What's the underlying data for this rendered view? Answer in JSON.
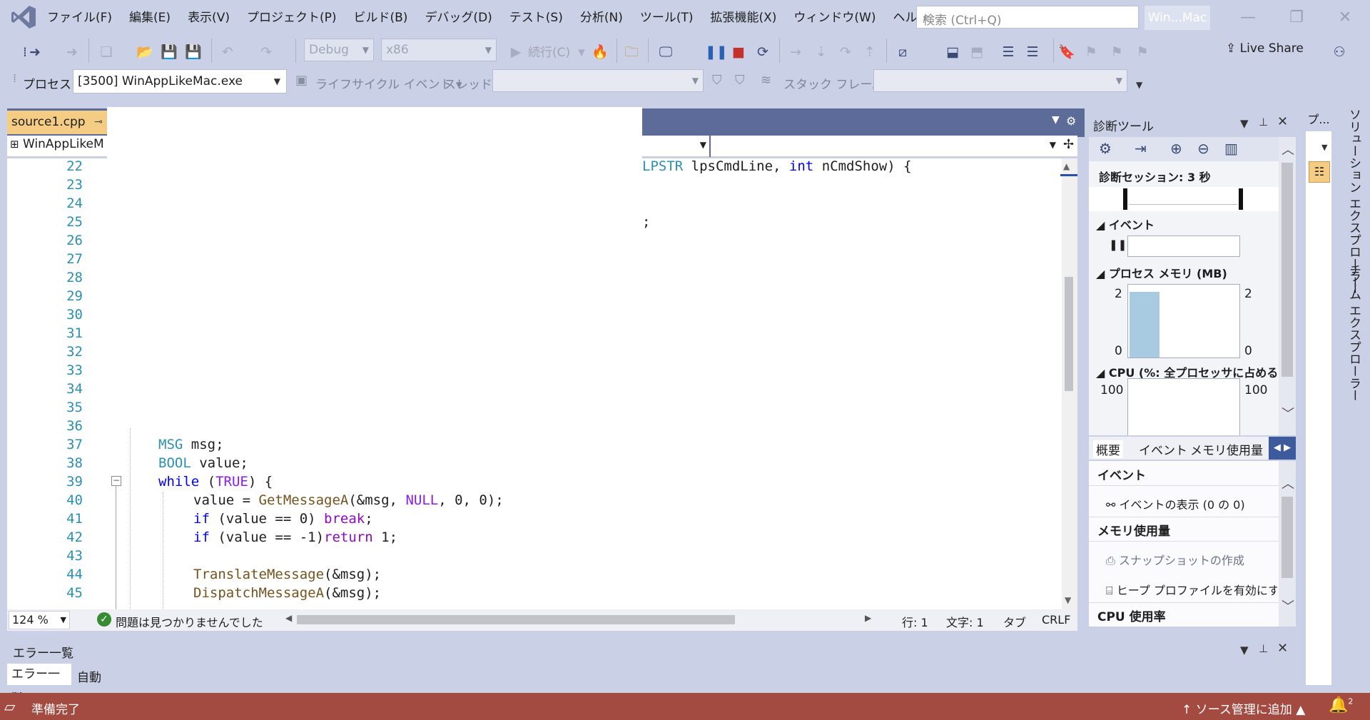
{
  "menu": {
    "items": [
      "ファイル(F)",
      "編集(E)",
      "表示(V)",
      "プロジェクト(P)",
      "ビルド(B)",
      "デバッグ(D)",
      "テスト(S)",
      "分析(N)",
      "ツール(T)",
      "拡張機能(X)",
      "ウィンドウ(W)",
      "ヘルプ(H)"
    ],
    "search_placeholder": "検索 (Ctrl+Q)",
    "window_badge": "Win...Mac"
  },
  "toolbar": {
    "config": "Debug",
    "platform": "x86",
    "continue_label": "続行(C)",
    "live_share": "Live Share"
  },
  "debug_bar": {
    "process_label": "プロセス:",
    "process_value": "[3500] WinAppLikeMac.exe",
    "lifecycle_label": "ライフサイクル イベント",
    "thread_label": "スレッド:",
    "stack_label": "スタック フレーム:"
  },
  "editor": {
    "tab_name": "source1.cpp",
    "tab_pin": "⊸",
    "nav_project": "WinAppLikeM",
    "line_numbers": [
      "22",
      "23",
      "24",
      "25",
      "26",
      "27",
      "28",
      "29",
      "30",
      "31",
      "32",
      "33",
      "34",
      "35",
      "36",
      "37",
      "38",
      "39",
      "40",
      "41",
      "42",
      "43",
      "44",
      "45"
    ],
    "line22_visible": {
      "type": "LPSTR",
      "arg1": " lpsCmdLine, ",
      "kw": "int",
      "arg2": " nCmdShow) {"
    },
    "line25_visible": ";",
    "line37": {
      "type": "MSG",
      "rest": " msg;"
    },
    "line38": {
      "type": "BOOL",
      "rest": " value;"
    },
    "line39": {
      "kw": "while",
      "p1": " (",
      "mac": "TRUE",
      "p2": ") {"
    },
    "line40": {
      "p1": "value = ",
      "fn": "GetMessageA",
      "p2": "(&msg, ",
      "mac": "NULL",
      "p3": ", 0, 0);"
    },
    "line41": {
      "kw": "if",
      "p1": " (value == 0) ",
      "ct": "break",
      "p2": ";"
    },
    "line42": {
      "kw": "if",
      "p1": " (value == -1)",
      "ct": "return",
      "p2": " 1;"
    },
    "line44": {
      "fn": "TranslateMessage",
      "rest": "(&msg);"
    },
    "line45": {
      "fn": "DispatchMessageA",
      "rest": "(&msg);"
    },
    "zoom": "124 %",
    "issues": "問題は見つかりませんでした",
    "line_pos": "行: 1",
    "char_pos": "文字: 1",
    "tab_mode": "タブ",
    "eol": "CRLF"
  },
  "diagnostics": {
    "title": "診断ツール",
    "session": "診断セッション: 3 秒",
    "events_section": "イベント",
    "memory_section": "プロセス メモリ (MB)",
    "mem_max_left": "2",
    "mem_min_left": "0",
    "mem_max_right": "2",
    "mem_min_right": "0",
    "mem_level": 0.9,
    "cpu_section": "CPU (%: 全プロセッサに占める割",
    "cpu_max_left": "100",
    "cpu_max_right": "100",
    "tabs": [
      "概要",
      "イベント",
      "メモリ使用量"
    ],
    "summary": {
      "events_head": "イベント",
      "show_events": "イベントの表示 (0 の 0)",
      "memory_head": "メモリ使用量",
      "snapshot": "スナップショットの作成",
      "heap": "ヒープ プロファイルを有効にす",
      "cpu_head": "CPU 使用率"
    }
  },
  "side": {
    "strip_head": "プ...",
    "solution_explorer": "ソリューション エクスプローラー",
    "team_explorer": "チーム エクスプローラー"
  },
  "error_list": {
    "title": "エラー一覧",
    "tab1": "エラー一覧",
    "tab2": "自動"
  },
  "status": {
    "ready": "準備完了",
    "source_control": "ソース管理に追加",
    "notification_count": "2"
  }
}
